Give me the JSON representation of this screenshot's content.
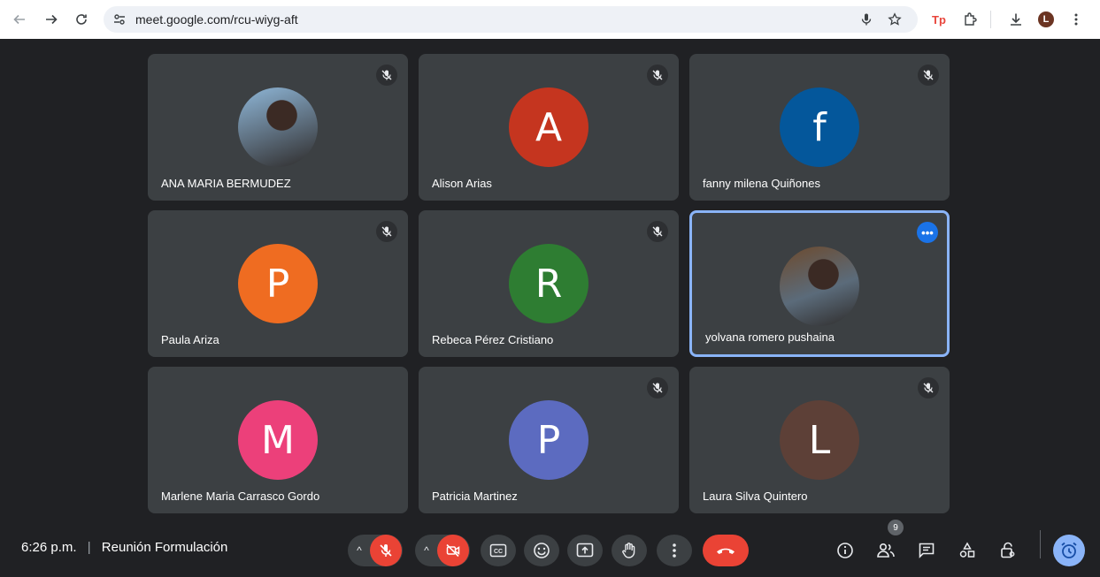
{
  "browser": {
    "url": "meet.google.com/rcu-wiyg-aft",
    "profile_initial": "L",
    "extension_label": "Tp"
  },
  "participants": [
    {
      "name": "ANA MARIA BERMUDEZ",
      "initial": "",
      "avatar_kind": "photo",
      "color": "#8fb7d8",
      "muted": true
    },
    {
      "name": "Alison Arias",
      "initial": "A",
      "avatar_kind": "letter",
      "color": "#c5351f",
      "muted": true
    },
    {
      "name": "fanny milena Quiñones",
      "initial": "f",
      "avatar_kind": "letter",
      "color": "#04579b",
      "muted": true
    },
    {
      "name": "Paula Ariza",
      "initial": "P",
      "avatar_kind": "letter",
      "color": "#ef6c21",
      "muted": true
    },
    {
      "name": "Rebeca Pérez Cristiano",
      "initial": "R",
      "avatar_kind": "letter",
      "color": "#2e7d32",
      "muted": true
    },
    {
      "name": "yolvana romero pushaina",
      "initial": "",
      "avatar_kind": "photo",
      "color": "#6d4a2d",
      "muted": false,
      "active": true
    },
    {
      "name": "Marlene Maria Carrasco Gordo",
      "initial": "M",
      "avatar_kind": "letter",
      "color": "#ec407a",
      "muted": false
    },
    {
      "name": "Patricia Martinez",
      "initial": "P",
      "avatar_kind": "letter",
      "color": "#5c6bc0",
      "muted": true
    },
    {
      "name": "Laura Silva Quintero",
      "initial": "L",
      "avatar_kind": "letter",
      "color": "#5d4037",
      "muted": true
    }
  ],
  "meeting": {
    "time": "6:26 p.m.",
    "separator": "|",
    "title": "Reunión Formulación",
    "participant_count": "9"
  },
  "controls": {
    "mic": "mic-off-icon",
    "camera": "camera-off-icon",
    "captions": "CC",
    "emoji": "emoji-icon",
    "present": "present-icon",
    "hand": "raise-hand-icon",
    "more": "more-vert-icon",
    "leave": "leave-call-icon"
  },
  "colors": {
    "accent": "#8ab4f8",
    "danger": "#ea4335",
    "tile_bg": "#3c4043",
    "stage_bg": "#202124"
  }
}
